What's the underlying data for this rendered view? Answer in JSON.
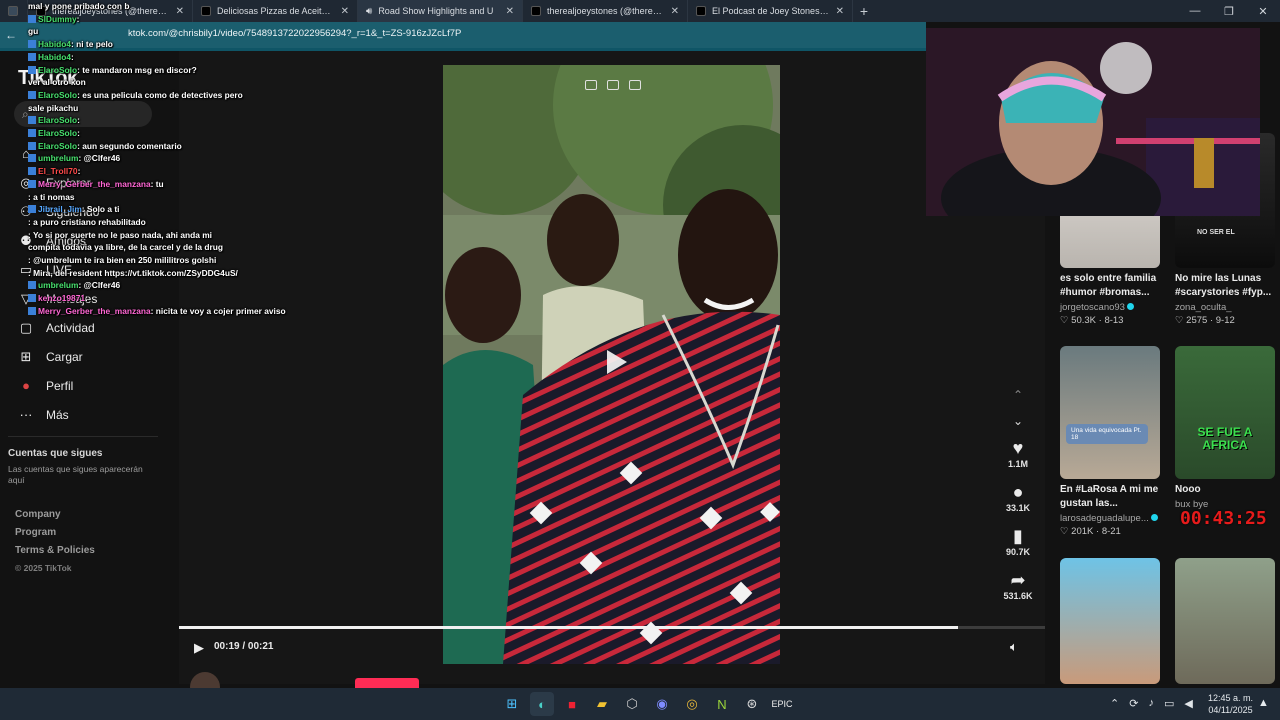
{
  "browser": {
    "tabs": [
      {
        "label": "therealjoeystones (@therealjoeyst"
      },
      {
        "label": "Deliciosas Pizzas de Aceite en la"
      },
      {
        "label": "Road Show Highlights and U"
      },
      {
        "label": "therealjoeystones (@therealjoeys"
      },
      {
        "label": "El Podcast de Joey Stones: Entrev"
      }
    ],
    "url": "ktok.com/@chrisbily1/video/7548913722022956294?_r=1&_t=ZS-916zJZcLf7P"
  },
  "sidebar": {
    "logo": "TikTok",
    "search_placeholder": "Q",
    "nav": [
      {
        "label": "",
        "icon": "home-icon"
      },
      {
        "label": "Explorar",
        "icon": "compass-icon"
      },
      {
        "label": "Siguiendo",
        "icon": "following-icon"
      },
      {
        "label": "Amigos",
        "icon": "friends-icon"
      },
      {
        "label": "LIVE",
        "icon": "live-icon"
      },
      {
        "label": "Mensajes",
        "icon": "messages-icon"
      },
      {
        "label": "Actividad",
        "icon": "activity-icon"
      },
      {
        "label": "Cargar",
        "icon": "upload-icon"
      },
      {
        "label": "Perfil",
        "icon": "profile-icon"
      },
      {
        "label": "Más",
        "icon": "more-icon"
      }
    ],
    "following_heading": "Cuentas que sigues",
    "following_sub": "Las cuentas que sigues aparecerán aquí",
    "footer": {
      "company": "Company",
      "program": "Program",
      "terms": "Terms & Policies",
      "copyright": "© 2025 TikTok"
    }
  },
  "chat": [
    {
      "user": "",
      "text": "mal y pone pribado con b",
      "color": "#ffffff"
    },
    {
      "user": "SlDummy",
      "text": ":",
      "color": "#48e06e"
    },
    {
      "user": "",
      "text": "gu",
      "color": "#48e06e"
    },
    {
      "user": "Habido4",
      "text": ": ni te pelo",
      "color": "#48e06e"
    },
    {
      "user": "Habido4",
      "text": ":",
      "color": "#48e06e"
    },
    {
      "user": "ElaroSolo",
      "text": ": te mandaron msg en discor?",
      "color": "#48e06e"
    },
    {
      "user": "",
      "text": "ver al otro kon",
      "color": "#ffffff"
    },
    {
      "user": "ElaroSolo",
      "text": ": es una pelicula como de detectives pero sale pikachu",
      "color": "#48e06e"
    },
    {
      "user": "ElaroSolo",
      "text": ":",
      "color": "#48e06e"
    },
    {
      "user": "ElaroSolo",
      "text": ":",
      "color": "#48e06e"
    },
    {
      "user": "ElaroSolo",
      "text": ": aun segundo comentario",
      "color": "#48e06e"
    },
    {
      "user": "umbrelum",
      "text": ": @Clfer46",
      "color": "#48e06e"
    },
    {
      "user": "El_Troll70",
      "text": ":",
      "color": "#ff4b4b"
    },
    {
      "user": "Merry_Gerber_the_manzana",
      "text": ": tu",
      "color": "#ff67d4"
    },
    {
      "user": "",
      "text": ": a ti nomas",
      "color": "#ffffff"
    },
    {
      "user": "Jibrail_Jim",
      "text": ": Solo a ti",
      "color": "#57a8ff"
    },
    {
      "user": "",
      "text": ": a puro cristiano rehabilitado",
      "color": "#ffffff"
    },
    {
      "user": "",
      "text": ": Yo si por suerte no le paso nada, ahi anda mi compita todavia ya libre, de la carcel y de la drug",
      "color": "#ffffff"
    },
    {
      "user": "",
      "text": ": @umbrelum te ira bien en 250 mililitros golshi",
      "color": "#ffffff"
    },
    {
      "user": "",
      "text": ": Mira, del resident https://vt.tiktok.com/ZSyDDG4uS/",
      "color": "#ffffff"
    },
    {
      "user": "umbrelum",
      "text": ": @Clfer46",
      "color": "#48e06e"
    },
    {
      "user": "kenzo19871",
      "text": ":",
      "color": "#ff67d4"
    },
    {
      "user": "Merry_Gerber_the_manzana",
      "text": ": nicita te voy a cojer primer aviso",
      "color": "#ff67d4"
    }
  ],
  "player": {
    "time": "00:19 / 00:21",
    "progress_fraction": 0.9,
    "author": "chrisbily1",
    "actions": [
      {
        "icon": "heart-icon",
        "count": "1.1M"
      },
      {
        "icon": "comment-icon",
        "count": "33.1K"
      },
      {
        "icon": "bookmark-icon",
        "count": "90.7K"
      },
      {
        "icon": "share-icon",
        "count": "531.6K"
      }
    ]
  },
  "rail": {
    "cards": [
      {
        "title": "es solo entre familia #humor #bromas...",
        "author": "jorgetoscano93",
        "verified": true,
        "likes": "50.3K",
        "date": "8-13"
      },
      {
        "title": "No mire las Lunas #scarystories #fyp...",
        "author": "zona_oculta_",
        "verified": false,
        "likes": "2575",
        "date": "9-12"
      },
      {
        "title": "En #LaRosa A mi me gustan las...",
        "author": "larosadeguadalupe...",
        "verified": true,
        "likes": "201K",
        "date": "8-21"
      },
      {
        "title": "Nooo",
        "author": "bux bye",
        "verified": false,
        "likes": "",
        "date": ""
      },
      {
        "title": "",
        "author": "",
        "verified": false,
        "likes": "",
        "date": ""
      },
      {
        "title": "",
        "author": "",
        "verified": false,
        "likes": "",
        "date": ""
      }
    ],
    "thumb_text_1": "Una vida equivocada Pt. 18",
    "thumb_text_2": "SE FUE A AFRICA",
    "thumb_text_3": "NO SER EL"
  },
  "overlay_timer": "00:43:25",
  "taskbar": {
    "time": "12:45 a. m.",
    "date": "04/11/2025"
  }
}
